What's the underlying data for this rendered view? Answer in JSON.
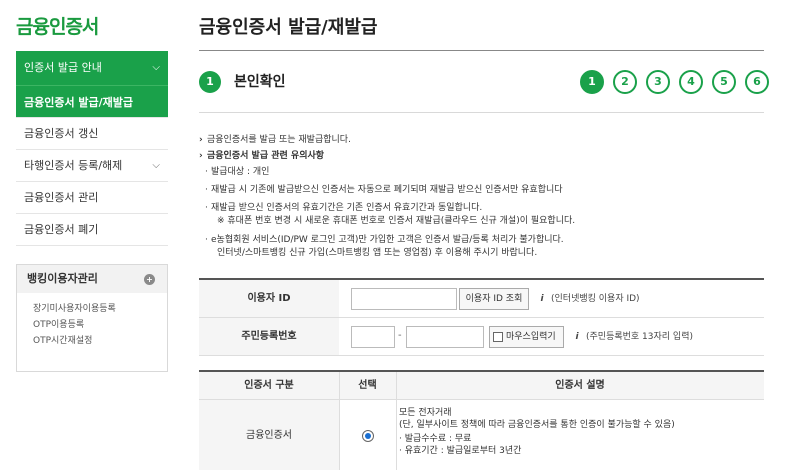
{
  "sidebar": {
    "title": "금융인증서",
    "menu": [
      {
        "label": "인증서 발급 안내",
        "has_chevron": true
      },
      {
        "label": "금융인증서 발급/재발급"
      },
      {
        "label": "금융인증서 갱신"
      },
      {
        "label": "타행인증서 등록/해제",
        "has_chevron": true
      },
      {
        "label": "금융인증서 관리"
      },
      {
        "label": "금융인증서 폐기"
      }
    ],
    "banking": {
      "title": "뱅킹이용자관리",
      "items": [
        "장기미사용자이용등록",
        "OTP이용등록",
        "OTP시간재설정"
      ]
    }
  },
  "main": {
    "page_title": "금융인증서 발급/재발급",
    "step_badge": "1",
    "step_title": "본인확인",
    "steps": [
      "1",
      "2",
      "3",
      "4",
      "5",
      "6"
    ],
    "current_step": "1",
    "notice": {
      "line1": "금융인증서를 발급 또는 재발급합니다.",
      "heading": "금융인증서 발급 관련 유의사항",
      "items": [
        "발급대상 : 개인",
        "재발급 시 기존에 발급받으신 인증서는 자동으로 폐기되며 재발급 받으신 인증서만 유효합니다",
        "재발급 받으신 인증서의 유효기간은 기존 인증서 유효기간과 동일합니다.",
        "※ 휴대폰 번호 변경 시 새로운 휴대폰 번호로 인증서 재발급(클라우드 신규 개설)이 필요합니다.",
        "e농협회원 서비스(ID/PW 로그인 고객)만 가입한 고객은 인증서 발급/등록 처리가 불가합니다.",
        "인터넷/스마트뱅킹 신규 가입(스마트뱅킹 앱 또는 영업점) 후 이용해 주시기 바랍니다."
      ]
    },
    "form": {
      "user_id_label": "이용자 ID",
      "user_id_value": "",
      "user_id_button": "이용자 ID 조회",
      "user_id_info": "(인터넷뱅킹 이용자 ID)",
      "rrn_label": "주민등록번호",
      "rrn_front": "",
      "rrn_dash": "-",
      "rrn_back": "",
      "mouse_input_label": "마우스입력기",
      "rrn_info": "(주민등록번호 13자리 입력)"
    },
    "cert_table": {
      "headers": [
        "인증서 구분",
        "선택",
        "인증서 설명"
      ],
      "rows": [
        {
          "type": "금융인증서",
          "selected": true,
          "desc1": "모든 전자거래",
          "desc2": "(단, 일부사이트 정책에 따라 금융인증서를 통한 인증이 불가능할 수 있음)",
          "desc3": "· 발급수수료 : 무료",
          "desc4": "· 유효기간 : 발급일로부터 3년간"
        }
      ]
    }
  },
  "colors": {
    "accent": "#1aa14a",
    "brand_title": "#1a9a3f",
    "radio": "#1a6fd1"
  }
}
